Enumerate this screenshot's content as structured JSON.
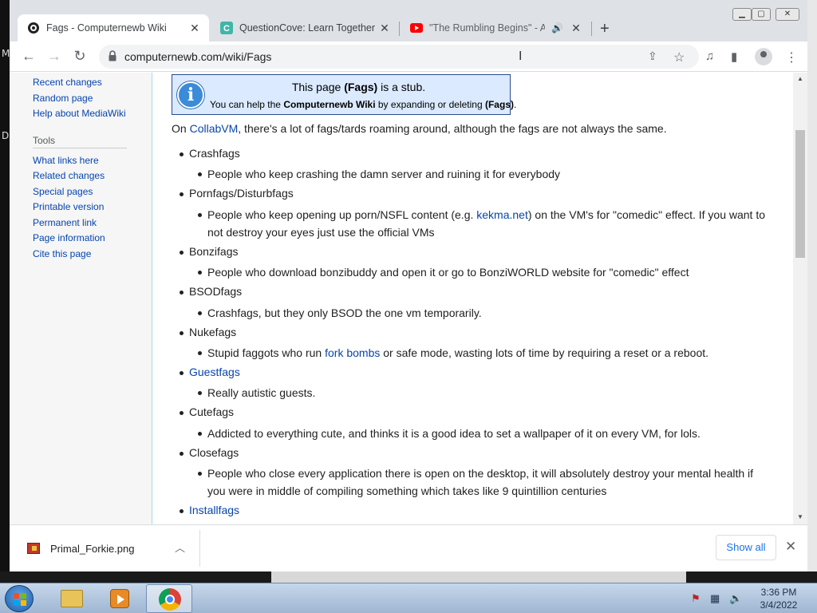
{
  "desktop": {
    "left_labels": [
      "M",
      "D"
    ]
  },
  "browser": {
    "tabs": [
      {
        "title": "Fags - Computernewb Wiki",
        "active": true
      },
      {
        "title": "QuestionCove: Learn Together",
        "active": false
      },
      {
        "title": "\"The Rumbling Begins\" - Atta",
        "active": false,
        "audio": true
      }
    ],
    "url": "computernewb.com/wiki/Fags"
  },
  "sidebar": {
    "nav_links": [
      "Recent changes",
      "Random page",
      "Help about MediaWiki"
    ],
    "tools_heading": "Tools",
    "tools_links": [
      "What links here",
      "Related changes",
      "Special pages",
      "Printable version",
      "Permanent link",
      "Page information",
      "Cite this page"
    ]
  },
  "stub": {
    "line1_pre": "This page ",
    "line1_bold": "(Fags)",
    "line1_post": " is a stub.",
    "line2_pre": "You can help the ",
    "line2_bold1": "Computernewb Wiki",
    "line2_mid": " by expanding or deleting ",
    "line2_bold2": "(Fags)",
    "line2_post": "."
  },
  "article": {
    "intro_pre": "On ",
    "intro_link": "CollabVM",
    "intro_post": ", there's a lot of fags/tards roaming around, although the fags are not always the same.",
    "entries": [
      {
        "term": "Crashfags",
        "desc": "People who keep crashing the damn server and ruining it for everybody"
      },
      {
        "term": "Pornfags/Disturbfags",
        "desc_pre": "People who keep opening up porn/NSFL content (e.g. ",
        "desc_link": "kekma.net",
        "desc_post": ") on the VM's for \"comedic\" effect. If you want to not destroy your eyes just use the official VMs"
      },
      {
        "term": "Bonzifags",
        "desc": "People who download bonzibuddy and open it or go to BonziWORLD website for \"comedic\" effect"
      },
      {
        "term": "BSODfags",
        "desc": "Crashfags, but they only BSOD the one vm temporarily."
      },
      {
        "term": "Nukefags",
        "desc_pre": "Stupid faggots who run ",
        "desc_link": "fork bombs",
        "desc_post": " or safe mode, wasting lots of time by requiring a reset or a reboot."
      },
      {
        "term": "Guestfags",
        "link": true,
        "desc": "Really autistic guests."
      },
      {
        "term": "Cutefags",
        "desc": "Addicted to everything cute, and thinks it is a good idea to set a wallpaper of it on every VM, for lols."
      },
      {
        "term": "Closefags",
        "desc": "People who close every application there is open on the desktop, it will absolutely destroy your mental health if you were in middle of compiling something which takes like 9 quintillion centuries"
      },
      {
        "term": "Installfags",
        "link": true
      }
    ]
  },
  "downloads": {
    "file_name": "Primal_Forkie.png",
    "show_all": "Show all"
  },
  "taskbar": {
    "time": "3:36 PM",
    "date": "3/4/2022"
  },
  "colors": {
    "link": "#0645ad",
    "stub_bg": "#dbeaff",
    "stub_border": "#2a4b8d",
    "sidebar_bg": "#f6f6f6"
  }
}
